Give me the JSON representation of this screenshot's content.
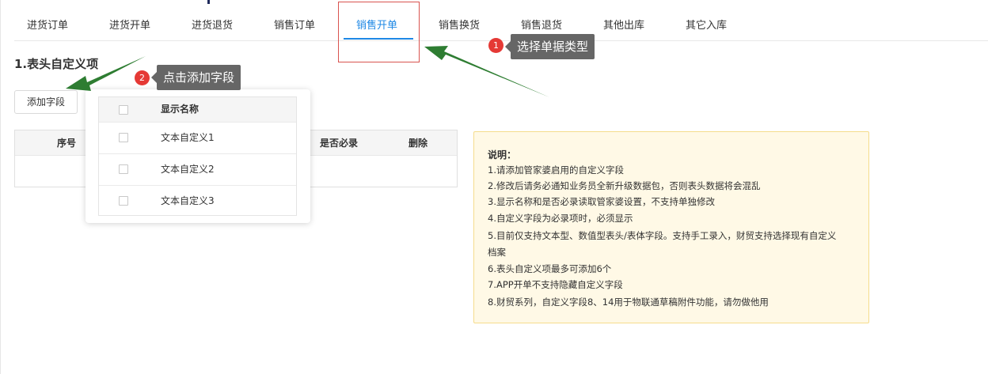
{
  "tabs": [
    {
      "label": "进货订单",
      "active": false
    },
    {
      "label": "进货开单",
      "active": false
    },
    {
      "label": "进货退货",
      "active": false
    },
    {
      "label": "销售订单",
      "active": false
    },
    {
      "label": "销售开单",
      "active": true
    },
    {
      "label": "销售换货",
      "active": false
    },
    {
      "label": "销售退货",
      "active": false
    },
    {
      "label": "其他出库",
      "active": false
    },
    {
      "label": "其它入库",
      "active": false
    }
  ],
  "section_title": "1.表头自定义项",
  "add_button_label": "添加字段",
  "main_table": {
    "columns": [
      "序号",
      "是否必录",
      "删除"
    ]
  },
  "popup": {
    "header": "显示名称",
    "rows": [
      "文本自定义1",
      "文本自定义2",
      "文本自定义3"
    ]
  },
  "note": {
    "title": "说明：",
    "lines": [
      "1.请添加管家婆启用的自定义字段",
      "2.修改后请务必通知业务员全新升级数据包，否则表头数据将会混乱",
      "3.显示名称和是否必录读取管家婆设置，不支持单独修改",
      "4.自定义字段为必录项时，必须显示",
      "5.目前仅支持文本型、数值型表头/表体字段。支持手工录入，财贸支持选择现有自定义",
      "档案",
      "6.表头自定义项最多可添加6个",
      "7.APP开单不支持隐藏自定义字段",
      "8.财贸系列，自定义字段8、14用于物联通草稿附件功能，请勿做他用"
    ]
  },
  "callouts": [
    {
      "number": "1",
      "text": "选择单据类型"
    },
    {
      "number": "2",
      "text": "点击添加字段"
    }
  ],
  "colors": {
    "accent": "#1e88e5",
    "highlight_border": "#d9534f",
    "arrow": "#2e7d32",
    "badge": "#e53935",
    "callout_bg": "#666666",
    "note_bg": "#fff9e6"
  }
}
